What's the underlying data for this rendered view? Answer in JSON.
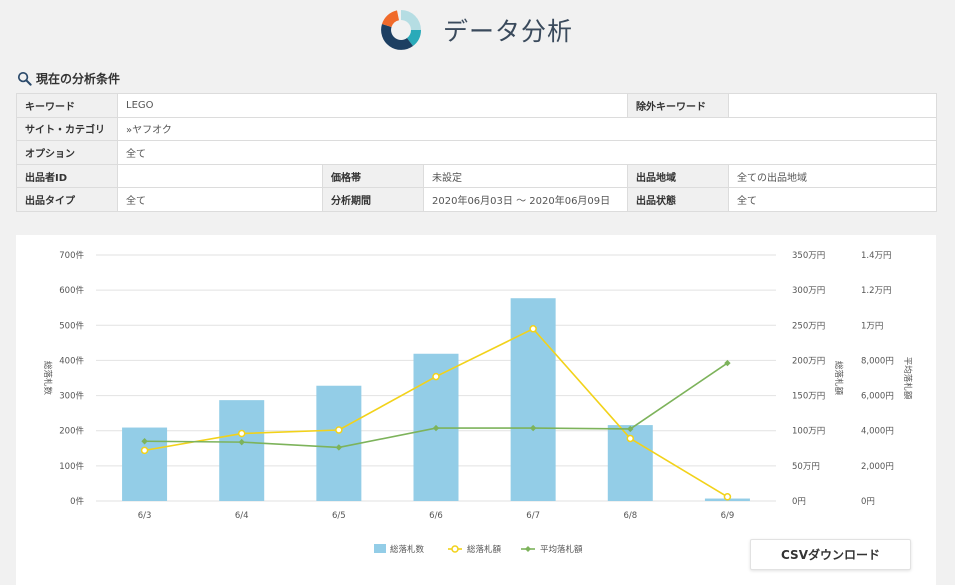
{
  "page": {
    "title": "データ分析"
  },
  "conditions": {
    "heading": "現在の分析条件",
    "keyword_label": "キーワード",
    "keyword_value": "LEGO",
    "exclude_label": "除外キーワード",
    "exclude_value": "",
    "site_label": "サイト・カテゴリ",
    "site_value": "»ヤフオク",
    "option_label": "オプション",
    "option_value": "全て",
    "seller_label": "出品者ID",
    "seller_value": "",
    "price_label": "価格帯",
    "price_value": "未設定",
    "region_label": "出品地域",
    "region_value": "全ての出品地域",
    "type_label": "出品タイプ",
    "type_value": "全て",
    "period_label": "分析期間",
    "period_value": "2020年06月03日 ～ 2020年06月09日",
    "state_label": "出品状態",
    "state_value": "全て"
  },
  "colors": {
    "bar": "#93cde7",
    "total_line": "#f2d21a",
    "avg_line": "#7db35b",
    "title": "#3a4a5c"
  },
  "chart_data": {
    "type": "bar",
    "categories": [
      "6/3",
      "6/4",
      "6/5",
      "6/6",
      "6/7",
      "6/8",
      "6/9"
    ],
    "series": [
      {
        "name": "総落札数",
        "type": "bar",
        "axis": "left",
        "values": [
          209,
          287,
          328,
          419,
          577,
          216,
          7
        ]
      },
      {
        "name": "総落札額",
        "type": "line",
        "axis": "right1",
        "values": [
          720000,
          960000,
          1010000,
          1770000,
          2450000,
          890000,
          60000
        ]
      },
      {
        "name": "平均落札額",
        "type": "line",
        "axis": "right2",
        "values": [
          3400,
          3350,
          3050,
          4150,
          4150,
          4100,
          7850
        ]
      }
    ],
    "y_left": {
      "label": "総落札数",
      "ylim": [
        0,
        700
      ],
      "ticks": [
        "0件",
        "100件",
        "200件",
        "300件",
        "400件",
        "500件",
        "600件",
        "700件"
      ]
    },
    "y_right1": {
      "label": "総落札額",
      "ylim": [
        0,
        3500000
      ],
      "ticks": [
        "0円",
        "50万円",
        "100万円",
        "150万円",
        "200万円",
        "250万円",
        "300万円",
        "350万円"
      ]
    },
    "y_right2": {
      "label": "平均落札額",
      "ylim": [
        0,
        14000
      ],
      "ticks": [
        "0円",
        "2,000円",
        "4,000円",
        "6,000円",
        "8,000円",
        "1万円",
        "1.2万円",
        "1.4万円"
      ]
    },
    "grid": true,
    "legend": "bottom"
  },
  "csv_button": {
    "label": "CSVダウンロード"
  }
}
